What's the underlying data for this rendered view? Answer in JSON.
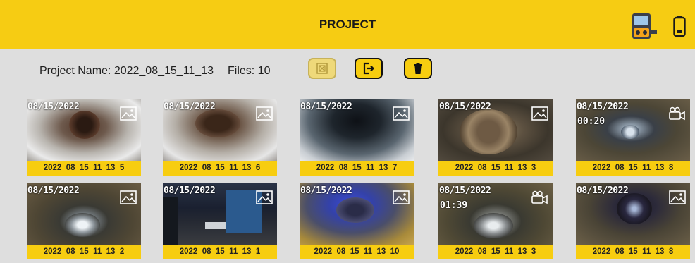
{
  "header": {
    "title": "PROJECT"
  },
  "project": {
    "name_text": "Project Name: 2022_08_15_11_13",
    "files_text": "Files: 10"
  },
  "colors": {
    "accent": "#f6cc13",
    "background": "#dedede",
    "label_text": "#222222"
  },
  "toolbar": {
    "buttons": [
      {
        "name": "select-all-button",
        "icon": "select-all-icon",
        "enabled": false
      },
      {
        "name": "export-button",
        "icon": "export-icon",
        "enabled": true
      },
      {
        "name": "delete-button",
        "icon": "trash-icon",
        "enabled": true
      }
    ]
  },
  "files": [
    {
      "label": "2022_08_15_11_13_5",
      "timestamp": "08/15/2022",
      "type": "photo",
      "badge_icon": "image-icon"
    },
    {
      "label": "2022_08_15_11_13_6",
      "timestamp": "08/15/2022",
      "type": "photo",
      "badge_icon": "image-icon"
    },
    {
      "label": "2022_08_15_11_13_7",
      "timestamp": "08/15/2022",
      "type": "photo",
      "badge_icon": "image-icon"
    },
    {
      "label": "2022_08_15_11_13_3",
      "timestamp": "08/15/2022",
      "type": "photo",
      "badge_icon": "image-icon"
    },
    {
      "label": "2022_08_15_11_13_8",
      "timestamp": "08/15/2022",
      "type": "video",
      "duration": "00:20",
      "badge_icon": "video-camera-icon"
    },
    {
      "label": "2022_08_15_11_13_2",
      "timestamp": "08/15/2022",
      "type": "photo",
      "badge_icon": "image-icon"
    },
    {
      "label": "2022_08_15_11_13_1",
      "timestamp": "08/15/2022",
      "type": "photo",
      "badge_icon": "image-icon"
    },
    {
      "label": "2022_08_15_11_13_10",
      "timestamp": "08/15/2022",
      "type": "photo",
      "badge_icon": "image-icon"
    },
    {
      "label": "2022_08_15_11_13_3",
      "timestamp": "08/15/2022",
      "type": "video",
      "duration": "01:39",
      "badge_icon": "video-camera-icon"
    },
    {
      "label": "2022_08_15_11_13_8",
      "timestamp": "08/15/2022",
      "type": "photo",
      "badge_icon": "image-icon"
    }
  ]
}
